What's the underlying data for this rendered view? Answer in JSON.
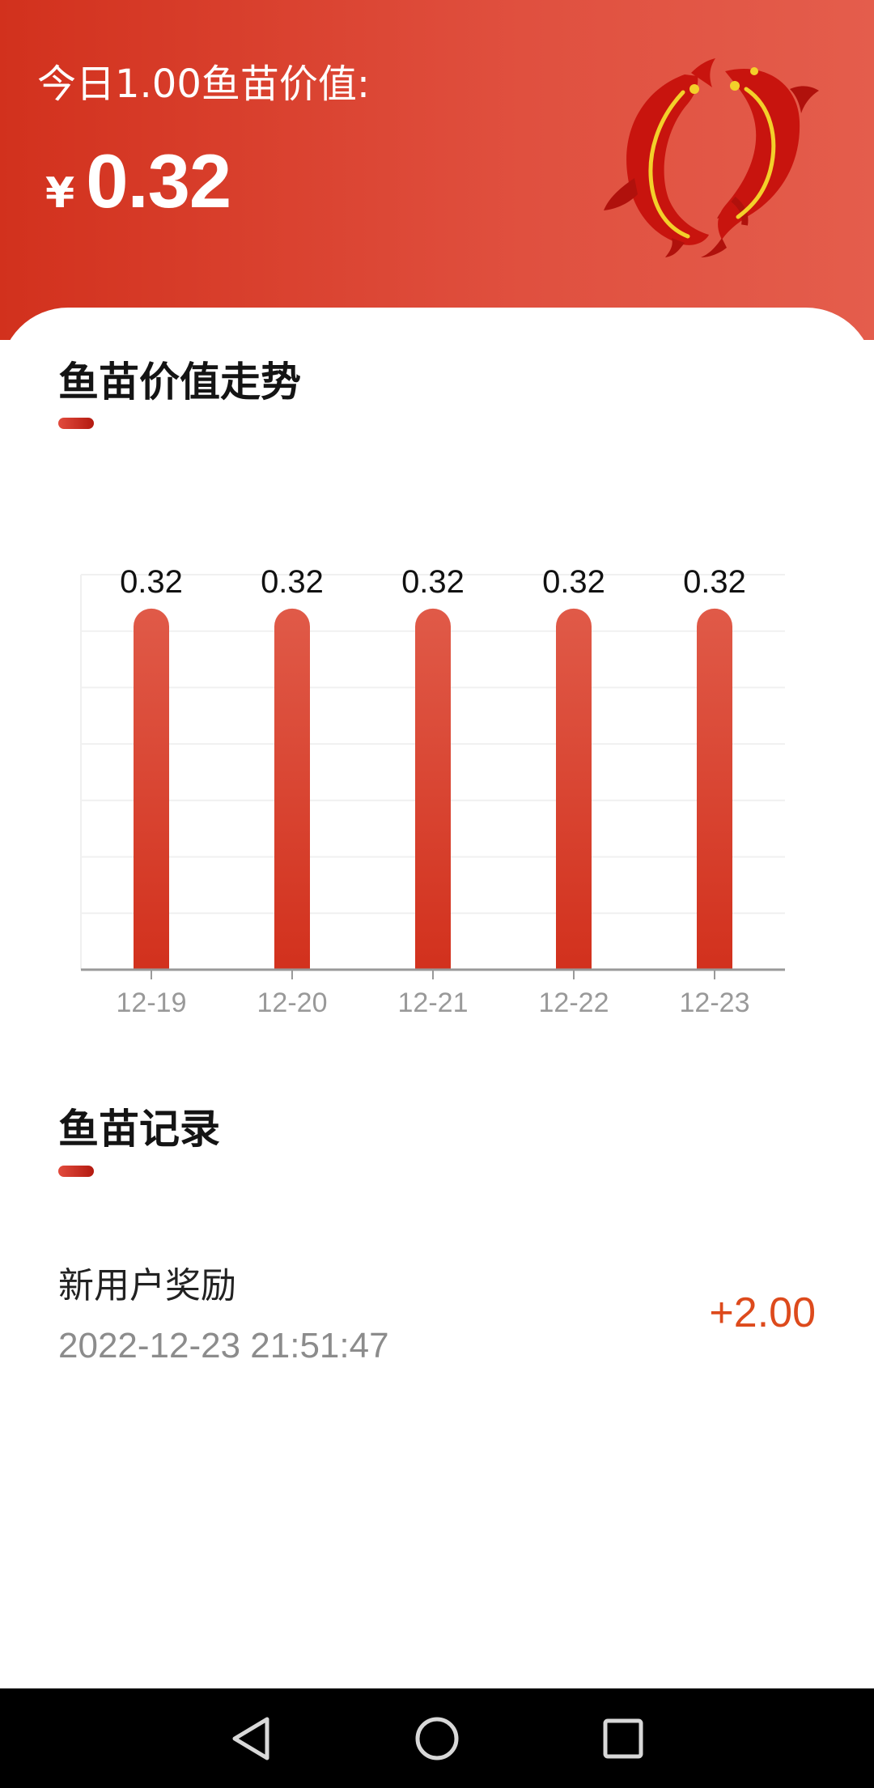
{
  "header": {
    "label": "今日1.00鱼苗价值:",
    "currency": "¥",
    "price": "0.32"
  },
  "trend_section": {
    "title": "鱼苗价值走势"
  },
  "chart_data": {
    "type": "bar",
    "categories": [
      "12-19",
      "12-20",
      "12-21",
      "12-22",
      "12-23"
    ],
    "values": [
      0.32,
      0.32,
      0.32,
      0.32,
      0.32
    ],
    "data_labels": [
      "0.32",
      "0.32",
      "0.32",
      "0.32",
      "0.32"
    ],
    "title": "",
    "xlabel": "",
    "ylabel": "",
    "ylim": [
      0,
      0.35
    ],
    "grid": true,
    "bar_color": "#d7321f"
  },
  "records_section": {
    "title": "鱼苗记录",
    "items": [
      {
        "title": "新用户奖励",
        "time": "2022-12-23 21:51:47",
        "amount": "+2.00"
      }
    ]
  },
  "colors": {
    "accent": "#d2311d",
    "amount": "#dd4a1c"
  },
  "navbar": {
    "back_icon": "back-triangle-icon",
    "home_icon": "home-circle-icon",
    "recents_icon": "recents-square-icon"
  }
}
